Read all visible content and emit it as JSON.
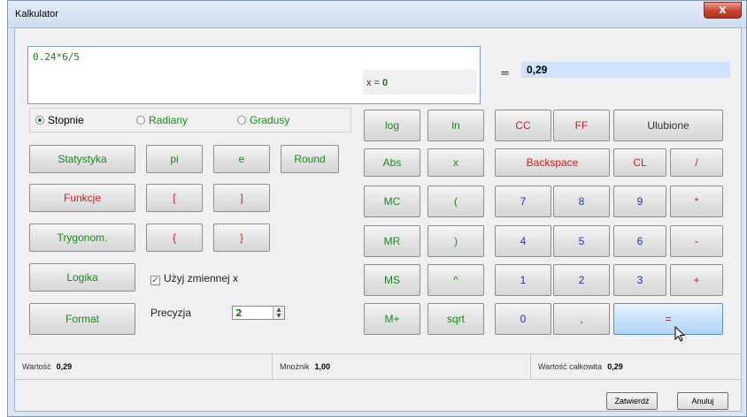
{
  "window": {
    "title": "Kalkulator",
    "close_glyph": "x"
  },
  "input": {
    "expression": "0.24*6/5",
    "x_label": "x = ",
    "x_value": "0"
  },
  "result": {
    "eq_sign": "=",
    "value": "0,29"
  },
  "angle_mode": {
    "options": [
      "Stopnie",
      "Radiany",
      "Gradusy"
    ],
    "selected": "Stopnie"
  },
  "left_buttons": {
    "statystyka": "Statystyka",
    "funkcje": "Funkcje",
    "trygonom": "Trygonom.",
    "logika": "Logika",
    "format": "Format",
    "pi": "pi",
    "e": "e",
    "round": "Round",
    "bracket_open": "[",
    "bracket_close": "]",
    "brace_open": "{",
    "brace_close": "}"
  },
  "use_x": {
    "label": "Użyj zmiennej x",
    "checked": true,
    "check_glyph": "✓"
  },
  "precision": {
    "label": "Precyzja",
    "value": "2",
    "up_glyph": "▲",
    "down_glyph": "▼"
  },
  "mid_buttons": {
    "log": "log",
    "ln": "ln",
    "abs": "Abs",
    "x": "x",
    "mc": "MC",
    "paren_open": "(",
    "mr": "MR",
    "paren_close": ")",
    "ms": "MS",
    "caret": "^",
    "mplus": "M+",
    "sqrt": "sqrt"
  },
  "right_buttons": {
    "cc": "CC",
    "ff": "FF",
    "ulubione": "Ulubione",
    "backspace": "Backspace",
    "cl": "CL",
    "div": "/",
    "mul": "*",
    "minus": "-",
    "plus": "+",
    "n7": "7",
    "n8": "8",
    "n9": "9",
    "n4": "4",
    "n5": "5",
    "n6": "6",
    "n1": "1",
    "n2": "2",
    "n3": "3",
    "n0": "0",
    "comma": ",",
    "equals": "="
  },
  "status": {
    "wartosc_label": "Wartość",
    "wartosc_value": "0,29",
    "mnoznik_label": "Mnożnik",
    "mnoznik_value": "1,00",
    "calkowita_label": "Wartość całkowita",
    "calkowita_value": "0,29"
  },
  "footer": {
    "confirm": "Zatwierdź",
    "cancel": "Anuluj"
  },
  "colors": {
    "function_text": "#1a8a1a",
    "operator_text": "#cc1f1f",
    "digit_text": "#2233bb",
    "result_bg": "#cfe2fb"
  }
}
